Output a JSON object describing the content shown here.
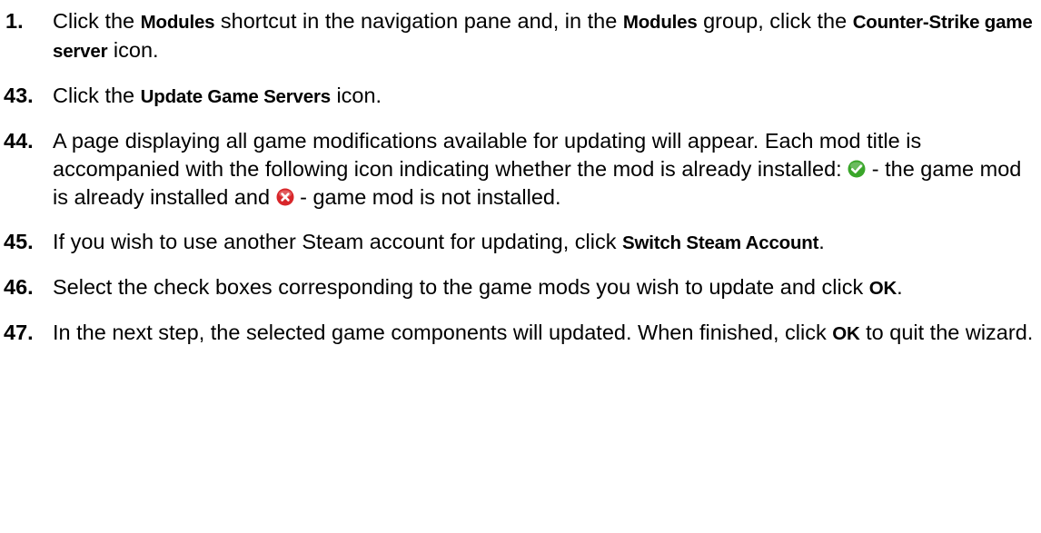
{
  "steps": [
    {
      "number": "1.",
      "parts": [
        {
          "t": "Click the "
        },
        {
          "b": "Modules"
        },
        {
          "t": " shortcut in the navigation pane and, in the "
        },
        {
          "b": "Modules"
        },
        {
          "t": " group, click the "
        },
        {
          "b": "Counter-Strike game server"
        },
        {
          "t": " icon."
        }
      ]
    },
    {
      "number": "43.",
      "parts": [
        {
          "t": "Click the "
        },
        {
          "b": "Update Game Servers"
        },
        {
          "t": " icon."
        }
      ]
    },
    {
      "number": "44.",
      "parts": [
        {
          "t": "A page displaying all game modifications available for updating will appear. Each mod title is accompanied with the following icon indicating whether the mod is already installed: "
        },
        {
          "icon": "check-circle-icon",
          "color": "#3aa62a"
        },
        {
          "t": " - the game mod is already installed and "
        },
        {
          "icon": "x-circle-icon",
          "color": "#d8262a"
        },
        {
          "t": " - game mod is not installed."
        }
      ]
    },
    {
      "number": "45.",
      "parts": [
        {
          "t": "If you wish to use another Steam account for updating, click "
        },
        {
          "b": "Switch Steam Account"
        },
        {
          "t": "."
        }
      ]
    },
    {
      "number": "46.",
      "parts": [
        {
          "t": "Select the check boxes corresponding to the game mods you wish to update and click "
        },
        {
          "b": "OK"
        },
        {
          "t": "."
        }
      ]
    },
    {
      "number": "47.",
      "parts": [
        {
          "t": "In the next step, the selected game components will updated. When finished, click "
        },
        {
          "b": "OK"
        },
        {
          "t": " to quit the wizard."
        }
      ]
    }
  ]
}
